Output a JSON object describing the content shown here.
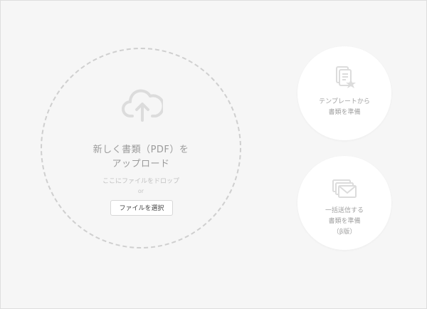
{
  "upload": {
    "title_line1": "新しく書類（PDF）を",
    "title_line2": "アップロード",
    "hint": "ここにファイルをドロップ",
    "or": "or",
    "select_button": "ファイルを選択",
    "icon": "cloud-upload-icon"
  },
  "template_card": {
    "line1": "テンプレートから",
    "line2": "書類を準備",
    "icon": "document-star-icon"
  },
  "bulk_card": {
    "line1": "一括送信する",
    "line2": "書類を準備",
    "line3": "（β版）",
    "icon": "envelopes-icon"
  },
  "colors": {
    "background": "#f6f6f6",
    "icon_gray": "#dcdcdc",
    "text_gray": "#9b9b9b"
  }
}
